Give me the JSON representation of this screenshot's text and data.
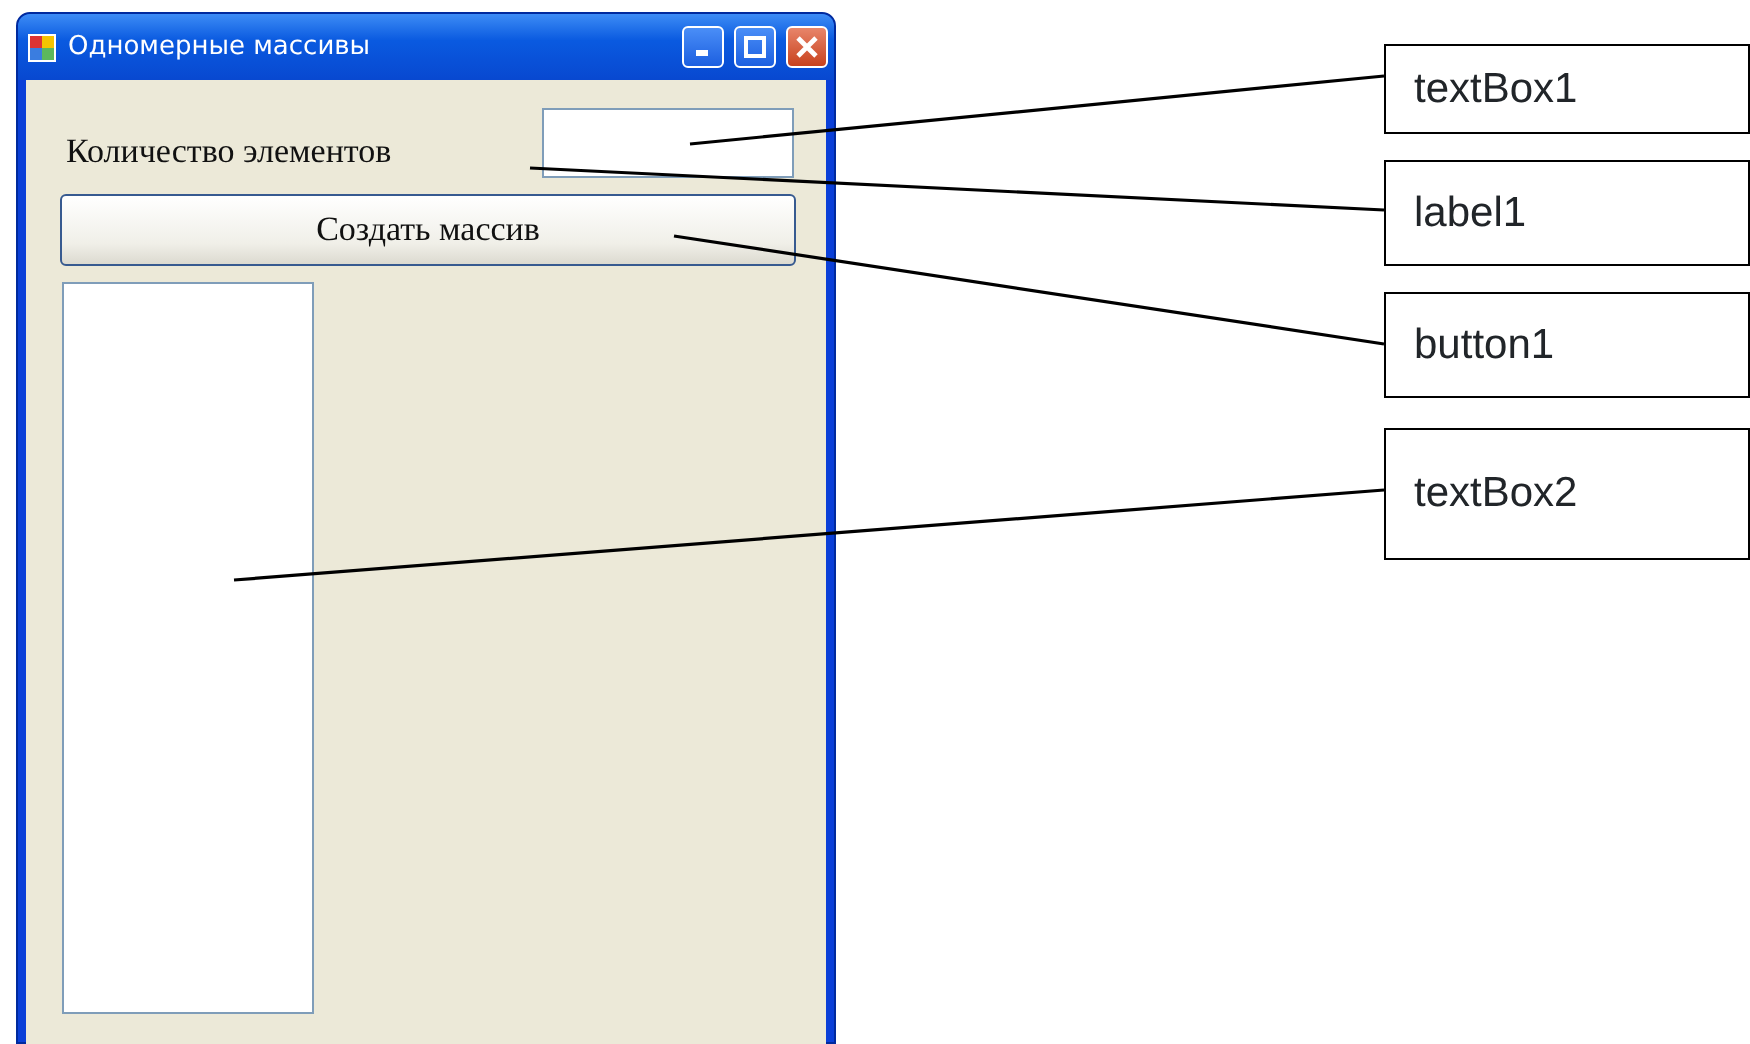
{
  "window": {
    "title": "Одномерные массивы"
  },
  "form": {
    "label": "Количество элементов",
    "button": "Создать массив"
  },
  "callouts": [
    {
      "text": "textBox1"
    },
    {
      "text": "label1"
    },
    {
      "text": "button1"
    },
    {
      "text": "textBox2"
    }
  ]
}
